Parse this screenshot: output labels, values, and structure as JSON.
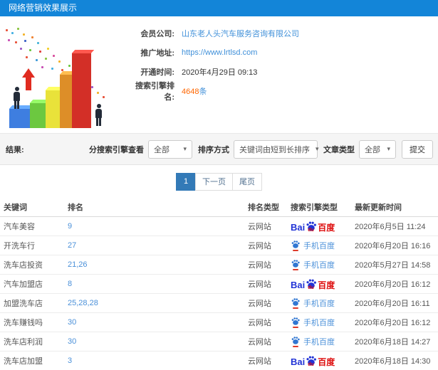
{
  "titlebar": {
    "title": "网络营销效果展示"
  },
  "info": {
    "company_label": "会员公司:",
    "company_value": "山东老人头汽车服务咨询有限公司",
    "url_label": "推广地址:",
    "url_value": "https://www.lrtlsd.com",
    "open_label": "开通时间:",
    "open_value": "2020年4月29日 09:13",
    "rank_label": "搜索引擎排名:",
    "rank_count": "4648",
    "rank_unit": "条"
  },
  "filters": {
    "result_label": "结果:",
    "engine_label": "分搜索引擎查看",
    "engine_value": "全部",
    "sort_label": "排序方式",
    "sort_value": "关键词由短到长排序",
    "article_label": "文章类型",
    "article_value": "全部",
    "submit_label": "提交",
    "caret": "▾"
  },
  "pagination": {
    "current": "1",
    "next": "下一页",
    "last": "尾页"
  },
  "table": {
    "columns": [
      "关键词",
      "排名",
      "排名类型",
      "搜索引擎类型",
      "最新更新时间"
    ],
    "engine_labels": {
      "baidu_bai": "Bai",
      "baidu_du": "du",
      "baidu_cn": "百度",
      "mobile": "手机百度"
    },
    "rows": [
      {
        "keyword": "汽车美容",
        "rank": "9",
        "rank_type": "云网站",
        "engine": "baidu",
        "time": "2020年6月5日 11:24"
      },
      {
        "keyword": "开洗车行",
        "rank": "27",
        "rank_type": "云网站",
        "engine": "mobile-baidu",
        "time": "2020年6月20日 16:16"
      },
      {
        "keyword": "洗车店投资",
        "rank": "21,26",
        "rank_type": "云网站",
        "engine": "mobile-baidu",
        "time": "2020年5月27日 14:58"
      },
      {
        "keyword": "汽车加盟店",
        "rank": "8",
        "rank_type": "云网站",
        "engine": "baidu",
        "time": "2020年6月20日 16:12"
      },
      {
        "keyword": "加盟洗车店",
        "rank": "25,28,28",
        "rank_type": "云网站",
        "engine": "mobile-baidu",
        "time": "2020年6月20日 16:11"
      },
      {
        "keyword": "洗车赚钱吗",
        "rank": "30",
        "rank_type": "云网站",
        "engine": "mobile-baidu",
        "time": "2020年6月20日 16:12"
      },
      {
        "keyword": "洗车店利润",
        "rank": "30",
        "rank_type": "云网站",
        "engine": "mobile-baidu",
        "time": "2020年6月18日 14:27"
      },
      {
        "keyword": "洗车店加盟",
        "rank": "3",
        "rank_type": "云网站",
        "engine": "baidu",
        "time": "2020年6月18日 14:30"
      }
    ]
  },
  "colors": {
    "header_bg": "#1385d8",
    "link_blue": "#4090d9",
    "count_orange": "#ff6600",
    "pagination_active_bg": "#337ab7",
    "baidu_blue": "#2133d6",
    "baidu_red": "#dd0a0a"
  }
}
